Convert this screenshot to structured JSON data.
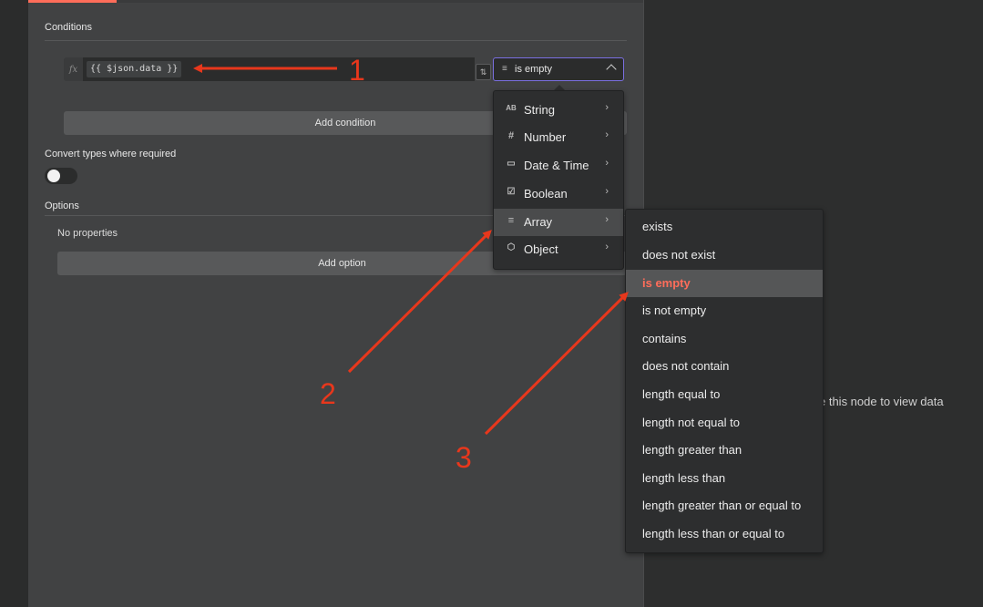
{
  "conditions": {
    "title": "Conditions",
    "fx_label": "fx",
    "expression": "{{ $json.data }}",
    "operator_selected": "is empty",
    "operator_icon": "list-lines-icon",
    "add_condition_label": "Add condition"
  },
  "convert_types": {
    "label": "Convert types where required",
    "enabled": false
  },
  "options": {
    "title": "Options",
    "empty_text": "No properties",
    "add_option_label": "Add option"
  },
  "type_menu": {
    "items": [
      {
        "label": "String",
        "icon": "AB"
      },
      {
        "label": "Number",
        "icon": "#"
      },
      {
        "label": "Date & Time",
        "icon": "▭"
      },
      {
        "label": "Boolean",
        "icon": "☑"
      },
      {
        "label": "Array",
        "icon": "≡"
      },
      {
        "label": "Object",
        "icon": "⬡"
      }
    ],
    "active": "Array"
  },
  "operator_menu": {
    "items": [
      "exists",
      "does not exist",
      "is empty",
      "is not empty",
      "contains",
      "does not contain",
      "length equal to",
      "length not equal to",
      "length greater than",
      "length less than",
      "length greater than or equal to",
      "length less than or equal to"
    ],
    "selected": "is empty"
  },
  "right_panel": {
    "hint": "e this node to view data"
  },
  "annotations": {
    "label_1": "1",
    "label_2": "2",
    "label_3": "3",
    "arrow_color": "#e8371c"
  },
  "colors": {
    "accent": "#ff6d5a",
    "focus_border": "#7a6fe0"
  }
}
